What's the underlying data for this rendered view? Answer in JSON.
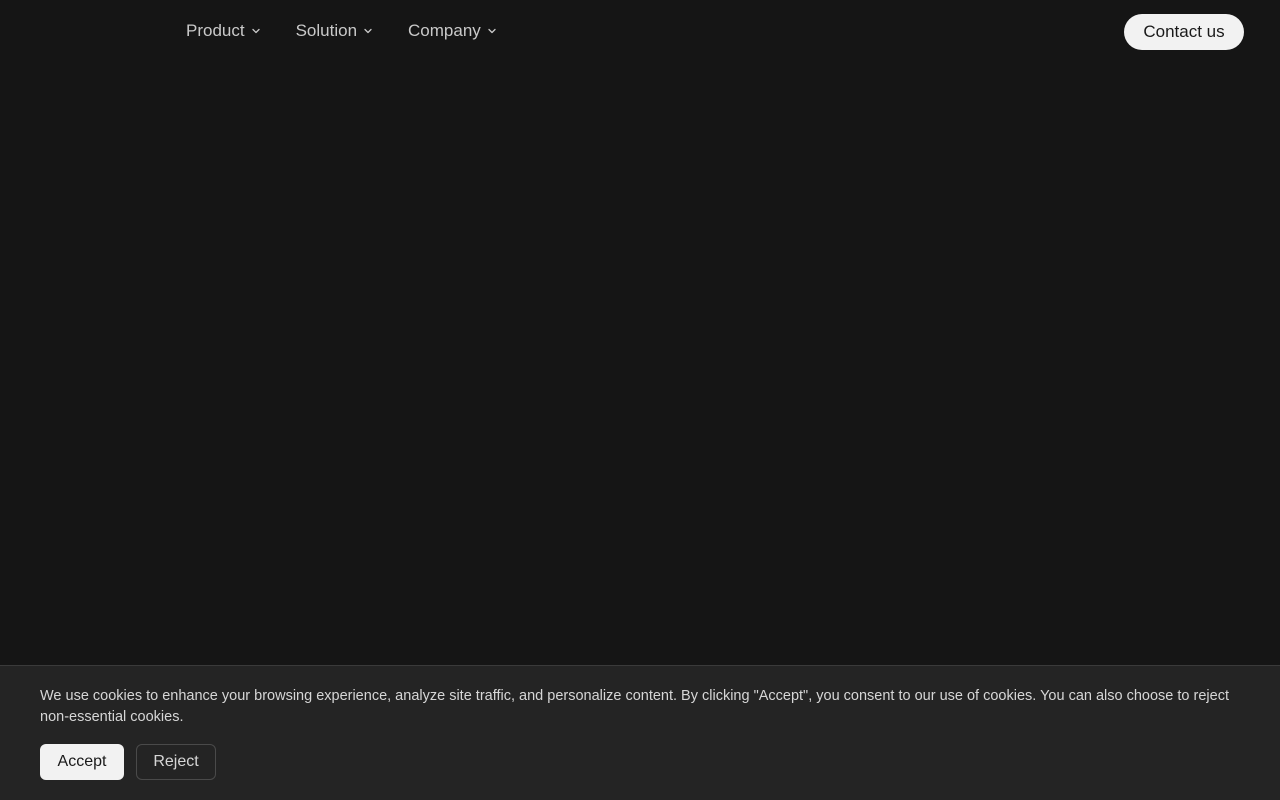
{
  "colors": {
    "background": "#151515",
    "banner_background": "#242424",
    "button_light": "#f2f2f2",
    "nav_text": "#c9c9c9"
  },
  "nav": {
    "items": [
      {
        "label": "Product",
        "icon": "chevron-down-icon"
      },
      {
        "label": "Solution",
        "icon": "chevron-down-icon"
      },
      {
        "label": "Company",
        "icon": "chevron-down-icon"
      }
    ],
    "contact_label": "Contact us"
  },
  "cookie_banner": {
    "message": "We use cookies to enhance your browsing experience, analyze site traffic, and personalize content. By clicking \"Accept\", you consent to our use of cookies. You can also choose to reject non-essential cookies.",
    "accept_label": "Accept",
    "reject_label": "Reject"
  }
}
